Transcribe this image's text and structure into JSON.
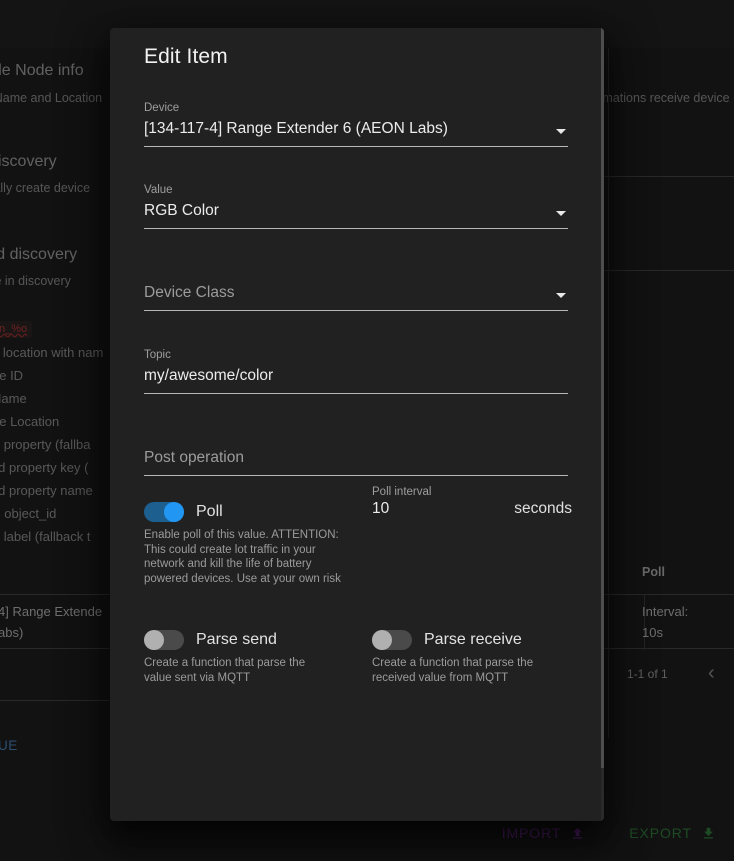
{
  "background": {
    "sections": [
      {
        "title": "ude Node info",
        "sub": "s Name and Location"
      },
      {
        "title": "s Discovery",
        "sub": "atically create device"
      },
      {
        "title": "ained discovery",
        "sub": "to true in discovery "
      }
    ],
    "right_text": "tomations receive device",
    "chip": "n_%o",
    "rows": [
      "e location with nam",
      "de ID",
      " Name",
      "de Location",
      "ld property (fallba",
      "eld property key (",
      "eld property name",
      "S object_id",
      "ld label (fallback t"
    ],
    "table": {
      "header_poll": "Poll",
      "device_cell_line1": "4] Range Extende",
      "device_cell_line2": "abs)",
      "poll_cell_line1": "Interval:",
      "poll_cell_line2": "10s",
      "pager": "1-1 of 1",
      "prev_chevron": "‹"
    },
    "value_link": "UE",
    "import_label": "IMPORT",
    "export_label": "EXPORT",
    "import_color": "#7b2f9e",
    "export_color": "#2f7a3a"
  },
  "dialog": {
    "title": "Edit Item",
    "fields": {
      "device": {
        "label": "Device",
        "value": "[134-117-4] Range Extender 6 (AEON Labs)",
        "is_placeholder": false
      },
      "value": {
        "label": "Value",
        "value": "RGB Color",
        "is_placeholder": false
      },
      "device_class": {
        "label": "",
        "value": "Device Class",
        "is_placeholder": true
      },
      "topic": {
        "label": "Topic",
        "value": "my/awesome/color",
        "is_placeholder": false
      },
      "post_operation": {
        "label": "",
        "value": "Post operation",
        "is_placeholder": true
      }
    },
    "poll": {
      "label": "Poll",
      "state": "on",
      "hint": "Enable poll of this value. ATTENTION: This could create lot traffic in your network and kill the life of battery powered devices. Use at your own risk"
    },
    "poll_interval": {
      "label": "Poll interval",
      "value": "10",
      "unit": "seconds"
    },
    "parse_send": {
      "label": "Parse send",
      "state": "off",
      "hint": "Create a function that parse the value sent via MQTT"
    },
    "parse_receive": {
      "label": "Parse receive",
      "state": "off",
      "hint": "Create a function that parse the received value from MQTT"
    }
  }
}
